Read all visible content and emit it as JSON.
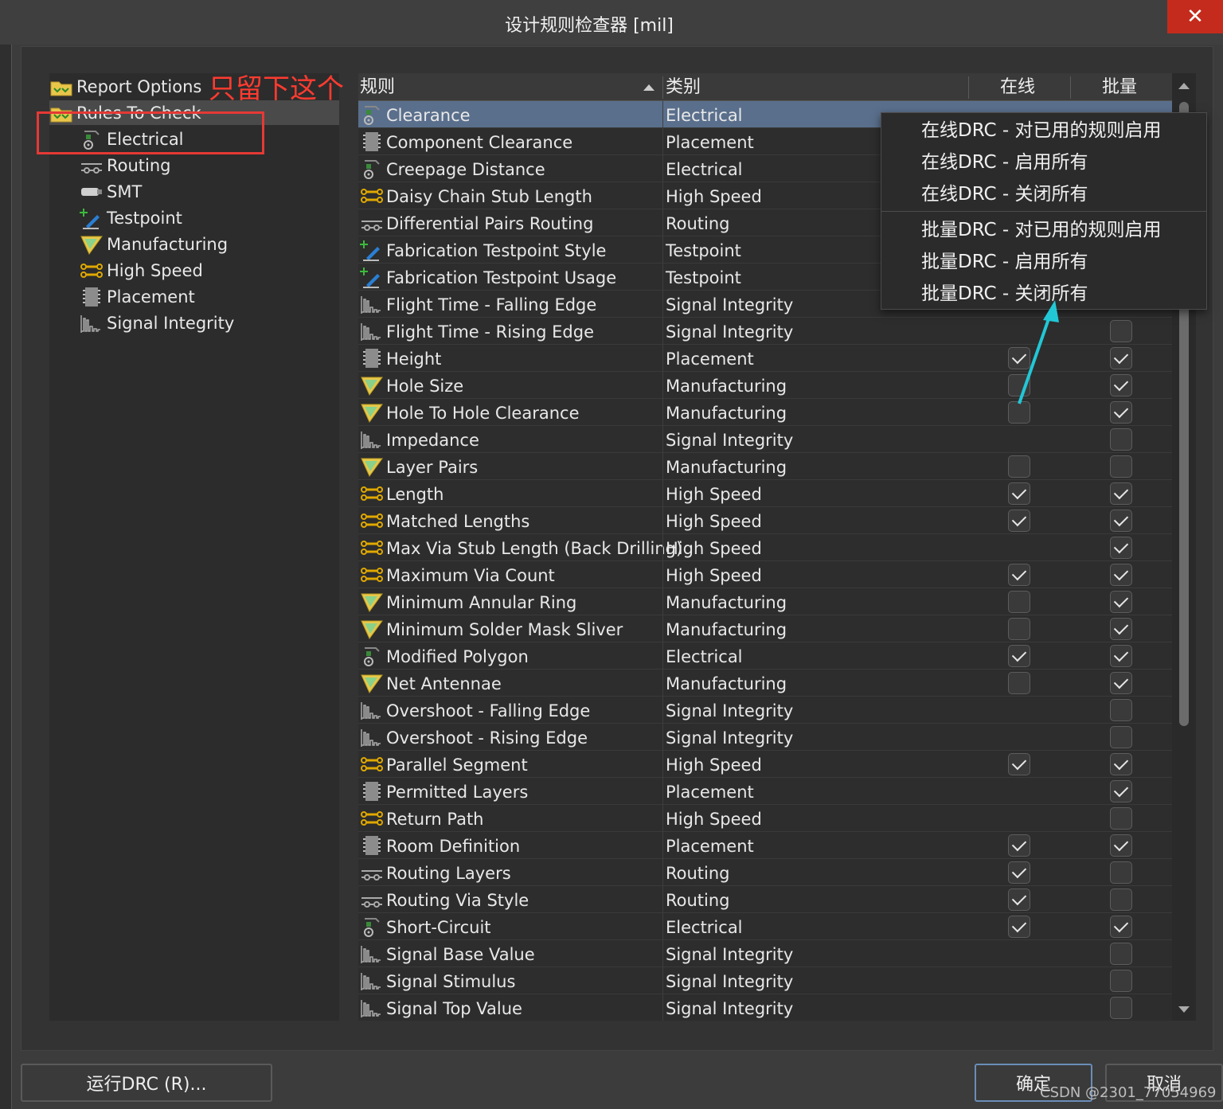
{
  "window": {
    "title": "设计规则检查器 [mil]",
    "close_label": "✕"
  },
  "annotation": {
    "text": "只留下这个"
  },
  "tree": {
    "items": [
      {
        "label": "Report Options",
        "icon": "folder-icon"
      },
      {
        "label": "Rules To Check",
        "icon": "folder-icon"
      },
      {
        "label": "Electrical",
        "icon": "electrical-icon"
      },
      {
        "label": "Routing",
        "icon": "routing-icon"
      },
      {
        "label": "SMT",
        "icon": "smt-icon"
      },
      {
        "label": "Testpoint",
        "icon": "testpoint-icon"
      },
      {
        "label": "Manufacturing",
        "icon": "manufacturing-icon"
      },
      {
        "label": "High Speed",
        "icon": "highspeed-icon"
      },
      {
        "label": "Placement",
        "icon": "placement-icon"
      },
      {
        "label": "Signal Integrity",
        "icon": "signal-icon"
      }
    ]
  },
  "grid": {
    "headers": {
      "rule": "规则",
      "category": "类别",
      "online": "在线",
      "batch": "批量"
    },
    "rows": [
      {
        "name": "Clearance",
        "category": "Electrical",
        "icon": "electrical-icon",
        "online": null,
        "batch": null,
        "selected": true
      },
      {
        "name": "Component Clearance",
        "category": "Placement",
        "icon": "placement-icon",
        "online": null,
        "batch": null
      },
      {
        "name": "Creepage Distance",
        "category": "Electrical",
        "icon": "electrical-icon",
        "online": null,
        "batch": null
      },
      {
        "name": "Daisy Chain Stub Length",
        "category": "High Speed",
        "icon": "highspeed-icon",
        "online": null,
        "batch": null
      },
      {
        "name": "Differential Pairs Routing",
        "category": "Routing",
        "icon": "routing-icon",
        "online": null,
        "batch": null
      },
      {
        "name": "Fabrication Testpoint Style",
        "category": "Testpoint",
        "icon": "testpoint-icon",
        "online": null,
        "batch": null
      },
      {
        "name": "Fabrication Testpoint Usage",
        "category": "Testpoint",
        "icon": "testpoint-icon",
        "online": null,
        "batch": null
      },
      {
        "name": "Flight Time - Falling Edge",
        "category": "Signal Integrity",
        "icon": "signal-icon",
        "online": null,
        "batch": null
      },
      {
        "name": "Flight Time - Rising Edge",
        "category": "Signal Integrity",
        "icon": "signal-icon",
        "online": null,
        "batch": false
      },
      {
        "name": "Height",
        "category": "Placement",
        "icon": "placement-icon",
        "online": true,
        "batch": true
      },
      {
        "name": "Hole Size",
        "category": "Manufacturing",
        "icon": "manufacturing-icon",
        "online": false,
        "batch": true
      },
      {
        "name": "Hole To Hole Clearance",
        "category": "Manufacturing",
        "icon": "manufacturing-icon",
        "online": false,
        "batch": true
      },
      {
        "name": "Impedance",
        "category": "Signal Integrity",
        "icon": "signal-icon",
        "online": null,
        "batch": false
      },
      {
        "name": "Layer Pairs",
        "category": "Manufacturing",
        "icon": "manufacturing-icon",
        "online": false,
        "batch": false
      },
      {
        "name": "Length",
        "category": "High Speed",
        "icon": "highspeed-icon",
        "online": true,
        "batch": true
      },
      {
        "name": "Matched Lengths",
        "category": "High Speed",
        "icon": "highspeed-icon",
        "online": true,
        "batch": true
      },
      {
        "name": "Max Via Stub Length (Back Drilling)",
        "category": "High Speed",
        "icon": "highspeed-icon",
        "online": null,
        "batch": true
      },
      {
        "name": "Maximum Via Count",
        "category": "High Speed",
        "icon": "highspeed-icon",
        "online": true,
        "batch": true
      },
      {
        "name": "Minimum Annular Ring",
        "category": "Manufacturing",
        "icon": "manufacturing-icon",
        "online": false,
        "batch": true
      },
      {
        "name": "Minimum Solder Mask Sliver",
        "category": "Manufacturing",
        "icon": "manufacturing-icon",
        "online": false,
        "batch": true
      },
      {
        "name": "Modified Polygon",
        "category": "Electrical",
        "icon": "electrical-icon",
        "online": true,
        "batch": true
      },
      {
        "name": "Net Antennae",
        "category": "Manufacturing",
        "icon": "manufacturing-icon",
        "online": false,
        "batch": true
      },
      {
        "name": "Overshoot - Falling Edge",
        "category": "Signal Integrity",
        "icon": "signal-icon",
        "online": null,
        "batch": false
      },
      {
        "name": "Overshoot - Rising Edge",
        "category": "Signal Integrity",
        "icon": "signal-icon",
        "online": null,
        "batch": false
      },
      {
        "name": "Parallel Segment",
        "category": "High Speed",
        "icon": "highspeed-icon",
        "online": true,
        "batch": true
      },
      {
        "name": "Permitted Layers",
        "category": "Placement",
        "icon": "placement-icon",
        "online": null,
        "batch": true
      },
      {
        "name": "Return Path",
        "category": "High Speed",
        "icon": "highspeed-icon",
        "online": null,
        "batch": false
      },
      {
        "name": "Room Definition",
        "category": "Placement",
        "icon": "placement-icon",
        "online": true,
        "batch": true
      },
      {
        "name": "Routing Layers",
        "category": "Routing",
        "icon": "routing-icon",
        "online": true,
        "batch": false
      },
      {
        "name": "Routing Via Style",
        "category": "Routing",
        "icon": "routing-icon",
        "online": true,
        "batch": false
      },
      {
        "name": "Short-Circuit",
        "category": "Electrical",
        "icon": "electrical-icon",
        "online": true,
        "batch": true
      },
      {
        "name": "Signal Base Value",
        "category": "Signal Integrity",
        "icon": "signal-icon",
        "online": null,
        "batch": false
      },
      {
        "name": "Signal Stimulus",
        "category": "Signal Integrity",
        "icon": "signal-icon",
        "online": null,
        "batch": false
      },
      {
        "name": "Signal Top Value",
        "category": "Signal Integrity",
        "icon": "signal-icon",
        "online": null,
        "batch": false
      }
    ]
  },
  "context_menu": {
    "items": [
      "在线DRC - 对已用的规则启用",
      "在线DRC - 启用所有",
      "在线DRC - 关闭所有",
      "批量DRC - 对已用的规则启用",
      "批量DRC - 启用所有",
      "批量DRC - 关闭所有"
    ]
  },
  "buttons": {
    "run_drc": "运行DRC (R)...",
    "ok": "确定",
    "cancel": "取消"
  },
  "watermark": "CSDN @2301_77054969",
  "colors": {
    "selected_row": "#5a6f8c",
    "annotation_red": "#e53935",
    "arrow_cyan": "#22c7d6"
  }
}
